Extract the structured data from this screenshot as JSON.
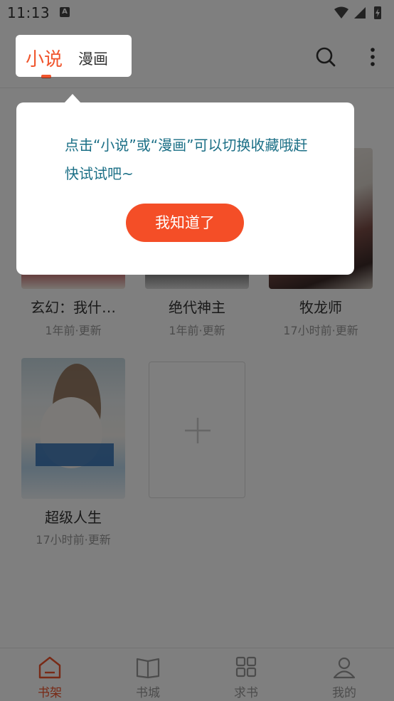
{
  "status_bar": {
    "time": "11:13",
    "notif_badge": "A"
  },
  "header": {
    "tabs": [
      {
        "label": "小说",
        "active": true
      },
      {
        "label": "漫画",
        "active": false
      }
    ],
    "accent_color": "#f0552d"
  },
  "shelf": {
    "books": [
      {
        "title": "玄幻：我什…",
        "update": "1年前·更新"
      },
      {
        "title": "绝代神主",
        "update": "1年前·更新"
      },
      {
        "title": "牧龙师",
        "update": "17小时前·更新"
      },
      {
        "title": "超级人生",
        "update": "17小时前·更新"
      }
    ],
    "add_icon": "plus-icon"
  },
  "bottom_nav": {
    "items": [
      {
        "label": "书架",
        "icon": "bookshelf-icon",
        "active": true
      },
      {
        "label": "书城",
        "icon": "open-book-icon",
        "active": false
      },
      {
        "label": "求书",
        "icon": "grid-icon",
        "active": false
      },
      {
        "label": "我的",
        "icon": "person-icon",
        "active": false
      }
    ]
  },
  "guide_popup": {
    "message": "点击“小说”或“漫画”可以切换收藏哦赶快试试吧~",
    "button_label": "我知道了",
    "button_color": "#f44e27",
    "text_color": "#1b6f86"
  }
}
